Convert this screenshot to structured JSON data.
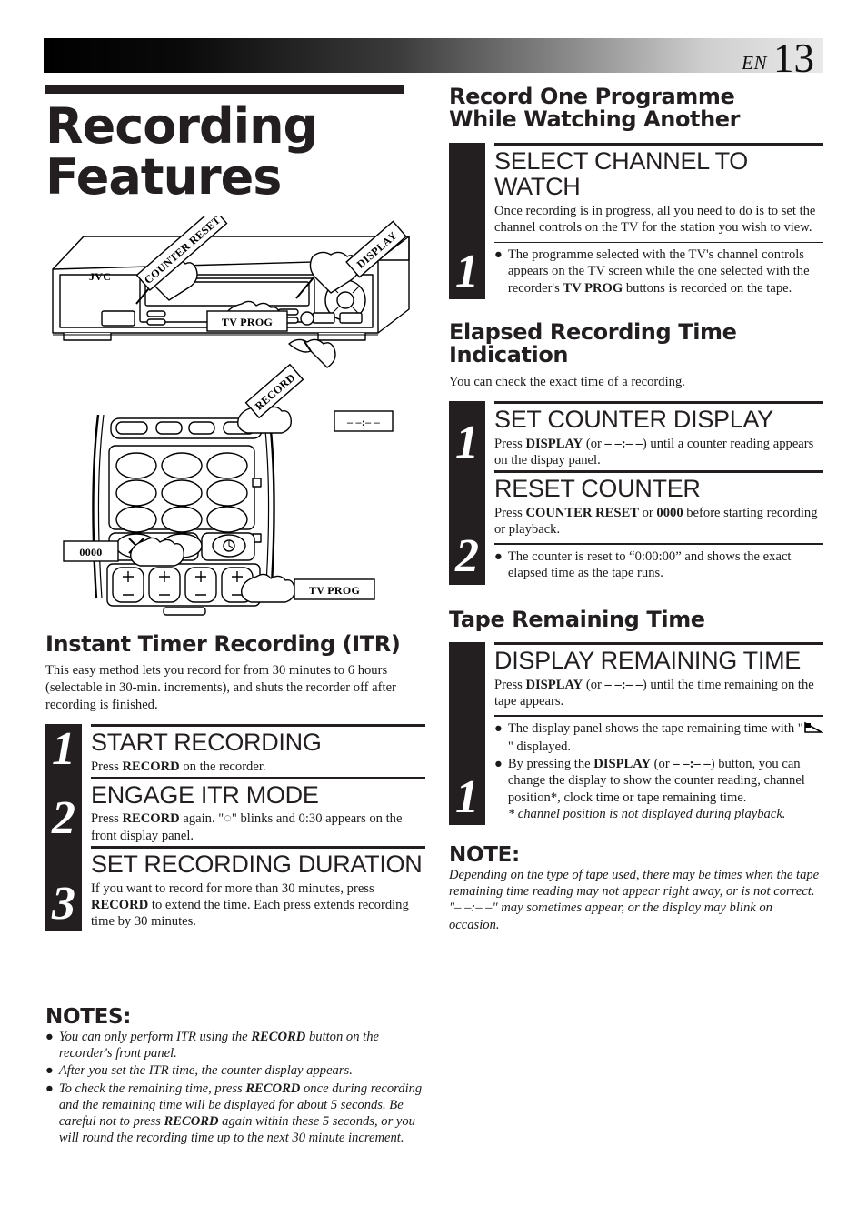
{
  "header": {
    "lang": "EN",
    "page_number": "13"
  },
  "title": {
    "line1": "Recording",
    "line2": "Features"
  },
  "illustration": {
    "brand": "JVC",
    "callouts": {
      "counter_reset": "COUNTER RESET",
      "display": "DISPLAY",
      "tv_prog_vcr": "TV PROG",
      "record": "RECORD",
      "zero_button": "0000",
      "dashes_button": "– –:– –",
      "tv_prog_remote": "TV PROG"
    }
  },
  "itr": {
    "heading": "Instant Timer Recording (ITR)",
    "intro": "This easy method lets you record for from 30 minutes to 6 hours (selectable in 30-min. increments), and shuts the recorder off after recording is finished.",
    "steps": [
      {
        "number": "1",
        "title": "START RECORDING",
        "body_parts": [
          {
            "text": "Press ",
            "bold": false
          },
          {
            "text": "RECORD",
            "bold": true
          },
          {
            "text": " on the recorder.",
            "bold": false
          }
        ]
      },
      {
        "number": "2",
        "title": "ENGAGE ITR MODE",
        "body_parts": [
          {
            "text": "Press ",
            "bold": false
          },
          {
            "text": "RECORD",
            "bold": true
          },
          {
            "text": " again. \"◌\" blinks and 0:30 appears on the front display panel.",
            "bold": false
          }
        ]
      },
      {
        "number": "3",
        "title": "SET RECORDING DURATION",
        "body_parts": [
          {
            "text": "If you want to record for more than 30 minutes, press ",
            "bold": false
          },
          {
            "text": "RECORD",
            "bold": true
          },
          {
            "text": " to extend the time. Each press extends recording time by 30 minutes.",
            "bold": false
          }
        ]
      }
    ]
  },
  "itr_notes": {
    "heading": "NOTES:",
    "items": [
      [
        {
          "text": "You can only perform ITR using the ",
          "bold": false
        },
        {
          "text": "RECORD",
          "bold": true
        },
        {
          "text": " button on the recorder's front panel.",
          "bold": false
        }
      ],
      [
        {
          "text": "After you set the ITR time, the counter display appears.",
          "bold": false
        }
      ],
      [
        {
          "text": "To check the remaining time, press ",
          "bold": false
        },
        {
          "text": "RECORD",
          "bold": true
        },
        {
          "text": " once during recording and the remaining time will be displayed for about 5 seconds. Be careful not to press ",
          "bold": false
        },
        {
          "text": "RECORD",
          "bold": true
        },
        {
          "text": " again within these 5 seconds, or you will round the recording time up to the next 30 minute increment.",
          "bold": false
        }
      ]
    ]
  },
  "record_one": {
    "heading_line1": "Record One Programme",
    "heading_line2": "While Watching Another",
    "steps": [
      {
        "number": "1",
        "title": "SELECT CHANNEL TO WATCH",
        "body_parts": [
          {
            "text": "Once recording is in progress, all you need to do is to set the channel controls on the TV for the station you wish to view.",
            "bold": false
          }
        ],
        "bullets": [
          [
            {
              "text": "The programme selected with the TV's channel controls appears on the TV screen while the one selected with the recorder's ",
              "bold": false
            },
            {
              "text": "TV PROG",
              "bold": true
            },
            {
              "text": " buttons is recorded on the tape.",
              "bold": false
            }
          ]
        ]
      }
    ]
  },
  "elapsed": {
    "heading_line1": "Elapsed Recording Time",
    "heading_line2": "Indication",
    "intro": "You can check the exact time of a recording.",
    "steps": [
      {
        "number": "1",
        "title": "SET COUNTER DISPLAY",
        "body_parts": [
          {
            "text": "Press ",
            "bold": false
          },
          {
            "text": "DISPLAY",
            "bold": true
          },
          {
            "text": " (or ",
            "bold": false
          },
          {
            "text": "– –:– –",
            "bold": true
          },
          {
            "text": ") until a counter reading appears on the dispay panel.",
            "bold": false
          }
        ],
        "bullets": []
      },
      {
        "number": "2",
        "title": "RESET COUNTER",
        "body_parts": [
          {
            "text": "Press ",
            "bold": false
          },
          {
            "text": "COUNTER RESET",
            "bold": true
          },
          {
            "text": " or ",
            "bold": false
          },
          {
            "text": "0000",
            "bold": true
          },
          {
            "text": " before starting recording or playback.",
            "bold": false
          }
        ],
        "bullets": [
          [
            {
              "text": "The counter is reset to “0:00:00” and shows the exact elapsed time as the tape runs.",
              "bold": false
            }
          ]
        ]
      }
    ]
  },
  "tape_remaining": {
    "heading": "Tape Remaining Time",
    "steps": [
      {
        "number": "1",
        "title": "DISPLAY REMAINING TIME",
        "body_parts": [
          {
            "text": "Press ",
            "bold": false
          },
          {
            "text": "DISPLAY",
            "bold": true
          },
          {
            "text": " (or ",
            "bold": false
          },
          {
            "text": "– –:– –",
            "bold": true
          },
          {
            "text": ") until the time remaining on the tape appears.",
            "bold": false
          }
        ],
        "bullets": [
          [
            {
              "text": "The display panel shows the tape remaining time with \"",
              "bold": false
            },
            {
              "text": "@tape-icon",
              "bold": false
            },
            {
              "text": "\" displayed.",
              "bold": false
            }
          ],
          [
            {
              "text": "By pressing the ",
              "bold": false
            },
            {
              "text": "DISPLAY",
              "bold": true
            },
            {
              "text": " (or ",
              "bold": false
            },
            {
              "text": "– –:– –",
              "bold": true
            },
            {
              "text": ") button, you can change the display to show the counter reading, channel position*, clock time or tape remaining time.",
              "bold": false
            },
            {
              "text": "\n* channel position is not displayed during playback.",
              "bold": false,
              "italic": true
            }
          ]
        ]
      }
    ]
  },
  "tape_note": {
    "heading": "NOTE:",
    "body": "Depending on the type of tape used, there may be times when the tape remaining time reading may not appear right away, or is not correct. \"– –:– –\" may sometimes appear, or the display may blink on occasion."
  },
  "colors": {
    "ink": "#231f20",
    "paper": "#ffffff"
  }
}
